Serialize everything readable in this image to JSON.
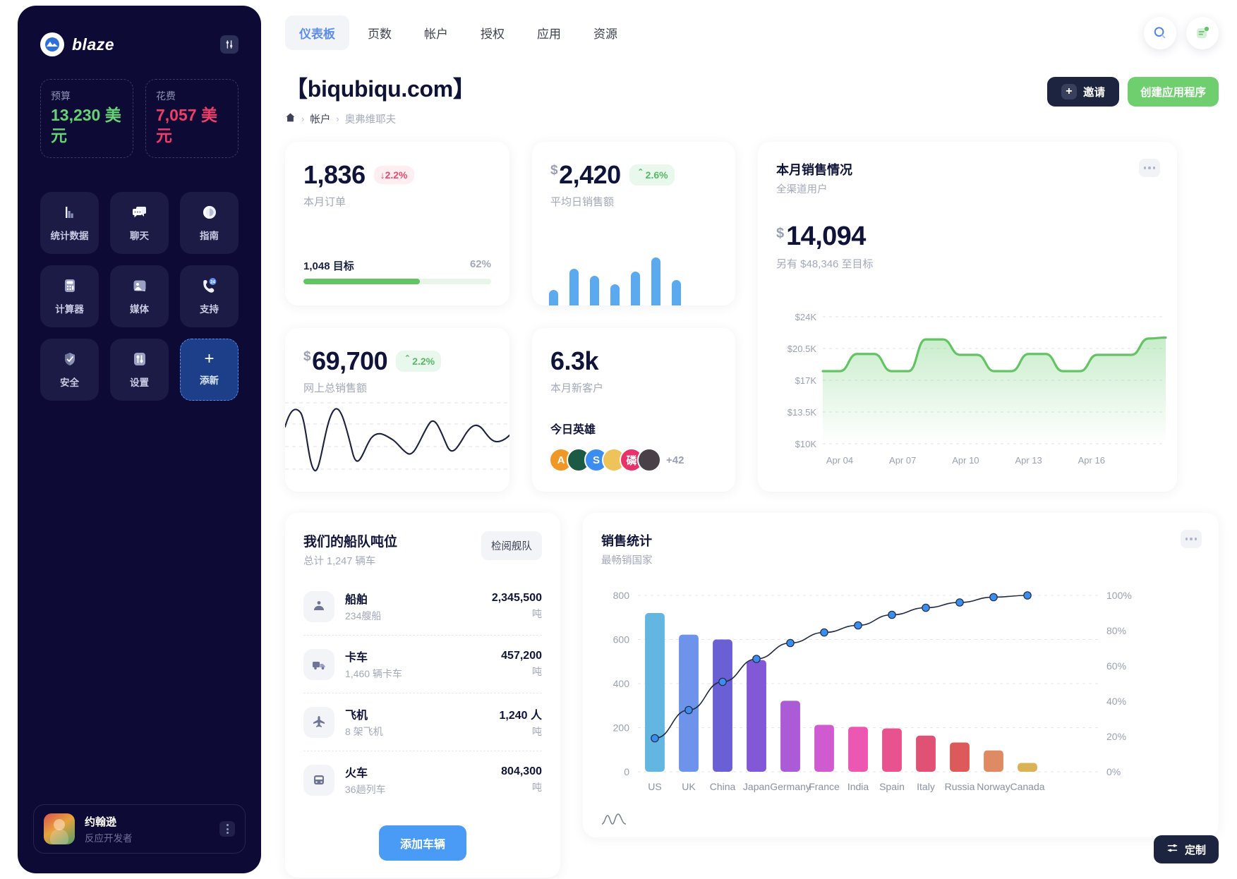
{
  "sidebar": {
    "brand": "blaze",
    "tools_icon": "sliders-icon",
    "budget": {
      "label": "预算",
      "value": "13,230 美元",
      "color": "#63d471"
    },
    "spend": {
      "label": "花费",
      "value": "7,057 美元",
      "color": "#ef3d68"
    },
    "nav": [
      {
        "label": "统计数据",
        "icon": "bar-chart-icon"
      },
      {
        "label": "聊天",
        "icon": "chat-bubble-icon"
      },
      {
        "label": "指南",
        "icon": "compass-icon"
      },
      {
        "label": "计算器",
        "icon": "calculator-icon"
      },
      {
        "label": "媒体",
        "icon": "image-icon"
      },
      {
        "label": "支持",
        "icon": "support-24-icon"
      },
      {
        "label": "安全",
        "icon": "shield-icon"
      },
      {
        "label": "设置",
        "icon": "sliders-icon"
      },
      {
        "label": "添新",
        "icon": "plus-icon"
      }
    ],
    "user": {
      "name": "约翰逊",
      "role": "反应开发者",
      "menu_icon": "dots-vertical-icon"
    }
  },
  "topbar": {
    "tabs": [
      {
        "label": "仪表板",
        "active": true
      },
      {
        "label": "页数",
        "active": false
      },
      {
        "label": "帐户",
        "active": false
      },
      {
        "label": "授权",
        "active": false
      },
      {
        "label": "应用",
        "active": false
      },
      {
        "label": "资源",
        "active": false
      }
    ],
    "search_icon": "search-icon",
    "notes_icon": "note-badge-icon"
  },
  "page": {
    "title": "【biqubiqu.com】",
    "breadcrumb": {
      "home_icon": "home-icon",
      "items": [
        "帐户",
        "奥弗维耶夫"
      ],
      "sep": "›"
    },
    "invite_button": "邀请",
    "invite_plus": "+",
    "create_button": "创建应用程序"
  },
  "kpis": {
    "orders": {
      "value": "1,836",
      "delta": "2.2%",
      "delta_dir": "down",
      "delta_arrow": "↓",
      "label": "本月订单",
      "goal_label": "1,048 目标",
      "goal_pct": "62%",
      "goal_fill": 62
    },
    "avg_daily": {
      "currency": "$",
      "value": "2,420",
      "delta": "2.6%",
      "delta_dir": "up",
      "delta_arrow": "＾",
      "label": "平均日销售额"
    },
    "total_online": {
      "currency": "$",
      "value": "69,700",
      "delta": "2.2%",
      "delta_dir": "up",
      "delta_arrow": "＾",
      "label": "网上总销售额"
    },
    "new_customers": {
      "value": "6.3k",
      "label": "本月新客户",
      "heroes_title": "今日英雄",
      "heroes": [
        {
          "initial": "A",
          "color": "#f09726"
        },
        {
          "initial": "",
          "color": "#1d5a44"
        },
        {
          "initial": "S",
          "color": "#3b8ef0"
        },
        {
          "initial": "",
          "color": "#edc35a"
        },
        {
          "initial": "磷",
          "color": "#e8326a"
        },
        {
          "initial": "",
          "color": "#4a4047"
        }
      ],
      "more": "+42"
    }
  },
  "sales_card": {
    "title": "本月销售情况",
    "subtitle": "全渠道用户",
    "currency": "$",
    "amount": "14,094",
    "note": "另有 $48,346 至目标",
    "menu_icon": "dots-horizontal-icon"
  },
  "fleet": {
    "title": "我们的船队吨位",
    "subtitle": "总计 1,247 辆车",
    "review_button": "检阅舰队",
    "add_button": "添加车辆",
    "items": [
      {
        "name": "船舶",
        "meta": "234艘船",
        "value": "2,345,500",
        "unit": "吨",
        "icon": "ship-icon"
      },
      {
        "name": "卡车",
        "meta": "1,460 辆卡车",
        "value": "457,200",
        "unit": "吨",
        "icon": "truck-icon"
      },
      {
        "name": "飞机",
        "meta": "8 架飞机",
        "value": "1,240 人",
        "unit": "吨",
        "icon": "plane-icon"
      },
      {
        "name": "火车",
        "meta": "36趟列车",
        "value": "804,300",
        "unit": "吨",
        "icon": "train-icon"
      }
    ]
  },
  "stats_card": {
    "title": "销售统计",
    "subtitle": "最畅销国家",
    "menu_icon": "dots-horizontal-icon",
    "footer_icon": "wave-icon"
  },
  "footer": {
    "customize_label": "定制",
    "customize_icon": "sliders-icon"
  },
  "chart_data": [
    {
      "type": "area",
      "name": "monthly-sales-area",
      "title": "本月销售情况",
      "subtitle": "全渠道用户",
      "xlabel": "",
      "ylabel": "",
      "ylim": [
        10000,
        24000
      ],
      "yticks": [
        "$10K",
        "$13.5K",
        "$17K",
        "$20.5K",
        "$24K"
      ],
      "ytick_values": [
        10000,
        13500,
        17000,
        20500,
        24000
      ],
      "xticks": [
        "Apr 04",
        "Apr 07",
        "Apr 10",
        "Apr 13",
        "Apr 16"
      ],
      "grid": true,
      "line_color": "#62c462",
      "x": [
        0,
        1,
        2,
        3,
        4,
        5,
        6,
        7,
        8,
        9,
        10,
        11,
        12,
        13,
        14,
        15,
        16,
        17,
        18,
        19,
        20
      ],
      "values": [
        18000,
        18000,
        19900,
        19900,
        18000,
        18000,
        21500,
        21500,
        19800,
        19800,
        18000,
        18000,
        19900,
        19900,
        18000,
        18000,
        19800,
        19800,
        19800,
        21600,
        21700
      ]
    },
    {
      "type": "bar",
      "name": "sales-by-country-pareto",
      "title": "销售统计",
      "subtitle": "最畅销国家",
      "categories": [
        "US",
        "UK",
        "China",
        "Japan",
        "Germany",
        "France",
        "India",
        "Spain",
        "Italy",
        "Russia",
        "Norway",
        "Canada"
      ],
      "values": [
        720,
        622,
        600,
        507,
        322,
        213,
        204,
        197,
        164,
        133,
        97,
        40
      ],
      "bar_colors": [
        "#62b6e0",
        "#6d93ea",
        "#6a5fd4",
        "#8358d6",
        "#ab5bd6",
        "#d05ad0",
        "#ec57b2",
        "#e8528f",
        "#df5274",
        "#dc5a5a",
        "#de8a63",
        "#d9b356"
      ],
      "ylabel": "",
      "ylim": [
        0,
        800
      ],
      "yticks": [
        "0",
        "200",
        "400",
        "600",
        "800"
      ],
      "ytick_values": [
        0,
        200,
        400,
        600,
        800
      ],
      "y2label": "",
      "y2lim": [
        0,
        100
      ],
      "y2ticks": [
        "0%",
        "20%",
        "40%",
        "60%",
        "80%",
        "100%"
      ],
      "y2tick_values": [
        0,
        20,
        40,
        60,
        80,
        100
      ],
      "grid": true,
      "series": [
        {
          "name": "cumulative-percent",
          "type": "line",
          "color": "#1f2a44",
          "marker_color": "#3b8ef0",
          "values": [
            19,
            35,
            51,
            64,
            73,
            79,
            83,
            89,
            93,
            96,
            99,
            100
          ]
        }
      ]
    },
    {
      "type": "bar",
      "name": "avg-daily-sales-minibars",
      "categories": [
        "1",
        "2",
        "3",
        "4",
        "5",
        "6",
        "7"
      ],
      "values": [
        22,
        52,
        42,
        30,
        48,
        68,
        36
      ],
      "color": "#5ba9ef",
      "ylim": [
        0,
        76
      ]
    }
  ]
}
